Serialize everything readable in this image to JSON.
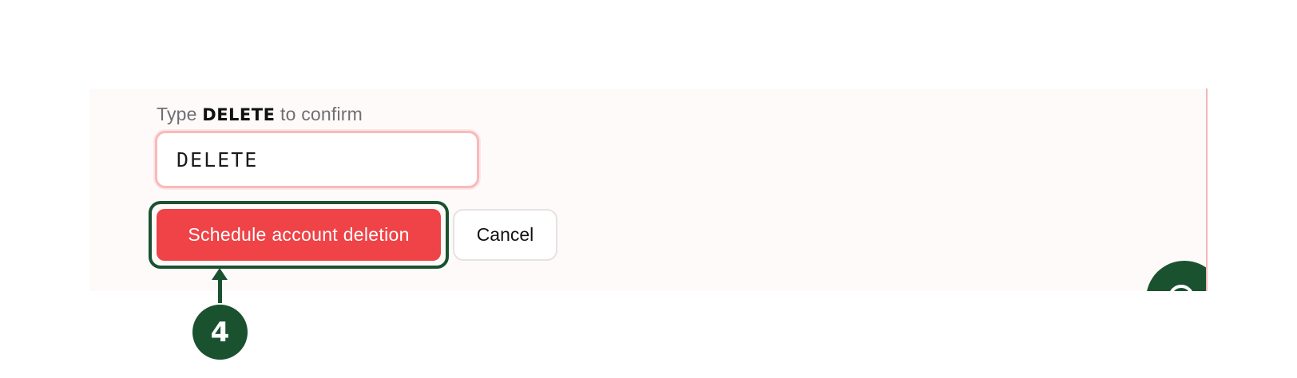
{
  "confirm": {
    "label_prefix": "Type",
    "label_keyword": "DELETE",
    "label_suffix": "to confirm",
    "input_value": "DELETE"
  },
  "actions": {
    "primary_label": "Schedule account deletion",
    "cancel_label": "Cancel"
  },
  "annotation": {
    "step_number": "4"
  },
  "help": {
    "icon": "help-circle-icon"
  },
  "colors": {
    "danger": "#ef4347",
    "accent": "#1a5230",
    "panel_bg": "#fffafa",
    "input_border": "#f9b9bb"
  }
}
